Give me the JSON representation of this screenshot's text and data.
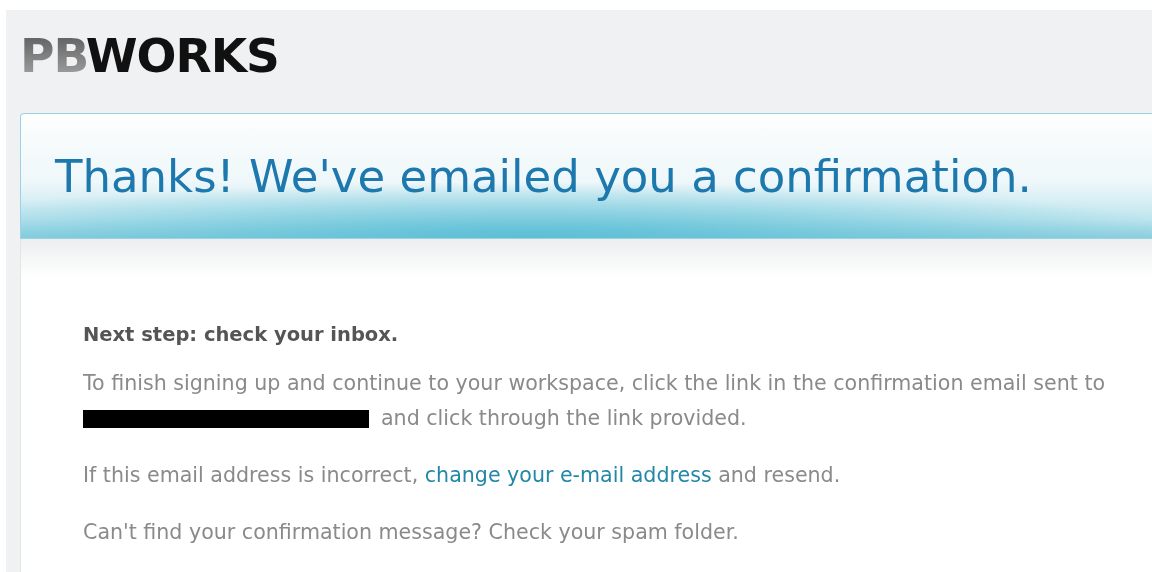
{
  "logo": {
    "parts": [
      {
        "text": "PB",
        "kind": "faded"
      },
      {
        "text": "WORKS",
        "kind": "solid"
      }
    ]
  },
  "banner": {
    "title": "Thanks! We've emailed you a confirmation."
  },
  "content": {
    "heading": "Next step: check your inbox.",
    "paragraphs": [
      {
        "kind": "redacted",
        "text": "To finish signing up and continue to your workspace, click the link in the confirmation email sent to",
        "after": "and click through the link provided."
      },
      {
        "kind": "link",
        "before": "If this email address is incorrect,",
        "link": "change your e-mail address",
        "after": "and resend."
      },
      {
        "kind": "plain",
        "text": "Can't find your confirmation message? Check your spam folder."
      }
    ]
  }
}
